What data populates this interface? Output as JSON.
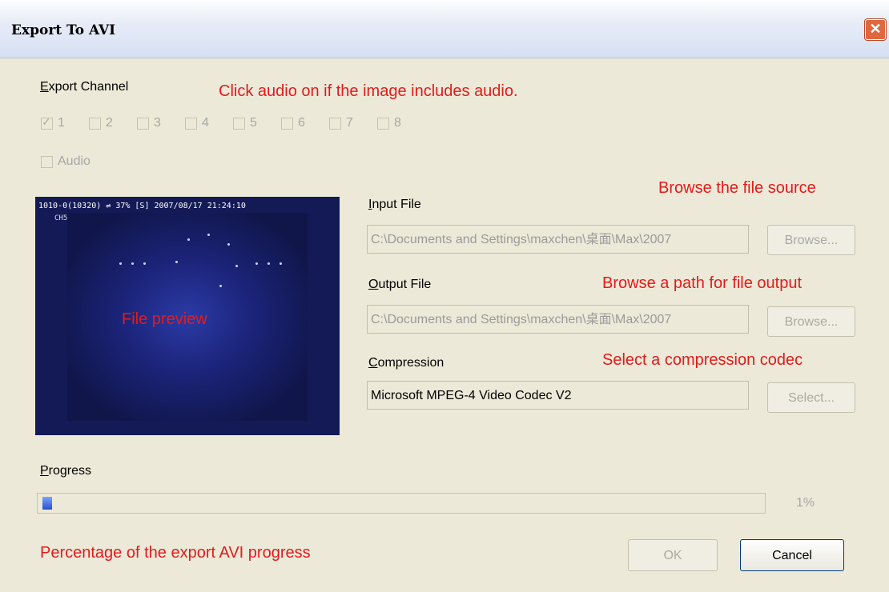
{
  "window": {
    "title": "Export To AVI",
    "close_glyph": "✕"
  },
  "export_channel": {
    "label_accel": "E",
    "label_rest": "xport Channel",
    "channels": [
      {
        "label": "1",
        "checked": true
      },
      {
        "label": "2",
        "checked": false
      },
      {
        "label": "3",
        "checked": false
      },
      {
        "label": "4",
        "checked": false
      },
      {
        "label": "5",
        "checked": false
      },
      {
        "label": "6",
        "checked": false
      },
      {
        "label": "7",
        "checked": false
      },
      {
        "label": "8",
        "checked": false
      }
    ],
    "audio_label": "Audio",
    "audio_checked": false
  },
  "preview": {
    "osd_text": "1010-0(10320)  ⇌     37% [S] 2007/08/17 21:24:10",
    "channel_text": "CH5",
    "caption": "File preview"
  },
  "input_file": {
    "label_accel": "I",
    "label_rest": "nput File",
    "value": "C:\\Documents and Settings\\maxchen\\桌面\\Max\\2007",
    "browse_label": "Browse..."
  },
  "output_file": {
    "label_accel": "O",
    "label_rest": "utput File",
    "value": "C:\\Documents and Settings\\maxchen\\桌面\\Max\\2007",
    "browse_label": "Browse..."
  },
  "compression": {
    "label_accel": "C",
    "label_rest": "ompression",
    "value": "Microsoft MPEG-4 Video Codec V2",
    "select_label": "Select..."
  },
  "progress": {
    "label_accel": "P",
    "label_rest": "rogress",
    "percent_text": "1%",
    "value": 0.01
  },
  "buttons": {
    "ok": "OK",
    "cancel": "Cancel"
  },
  "annotations": {
    "audio_tip": "Click audio on if the image includes audio.",
    "browse_source_tip": "Browse the file source",
    "browse_output_tip": "Browse a path for file output",
    "codec_tip": "Select a compression codec",
    "progress_tip": "Percentage of the export AVI progress"
  }
}
